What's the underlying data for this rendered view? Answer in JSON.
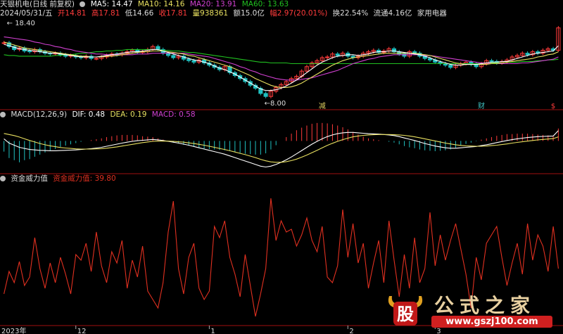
{
  "header": {
    "stock": "天银机电(日线 前复权)",
    "ma5": "MA5: 14.47",
    "ma10": "MA10: 14.16",
    "ma20": "MA20: 13.91",
    "ma60": "MA60: 13.63",
    "date": "2024/05/31/五",
    "open": "开14.81",
    "high": "高17.81",
    "low": "低14.66",
    "close": "收17.81",
    "volume": "量938361",
    "amount": "额15.0亿",
    "change": "幅2.97(20.01%)",
    "turnover": "换22.54%",
    "float": "流通4.16亿",
    "industry": "家用电器"
  },
  "macd_header": {
    "label": "MACD(12,26,9)",
    "dif": "DIF: 0.48",
    "dea": "DEA: 0.19",
    "macd": "MACD: 0.58"
  },
  "power_header": {
    "label": "资金威力值",
    "value": "资金威力值: 39.80"
  },
  "colors": {
    "up": "#ff3b3b",
    "down": "#20c0c0",
    "ma5": "#ffffff",
    "ma10": "#e8e060",
    "ma20": "#d040d0",
    "ma60": "#20c020",
    "dif": "#ffffff",
    "dea": "#e8e060",
    "power": "#e03020",
    "grid": "#a01010",
    "label_yellow": "#e0d060",
    "label_cyan": "#40c0c0"
  },
  "chart_data": [
    {
      "type": "candlestick",
      "title": "天银机电(日线 前复权)",
      "price_labels": {
        "high": "18.40",
        "low": "8.00"
      },
      "ylim": [
        7.2,
        18.9
      ],
      "markers": [
        {
          "text": "减",
          "index": 62
        },
        {
          "text": "财",
          "index": 93
        },
        {
          "text": "$",
          "index": 107
        }
      ],
      "closes": [
        15.8,
        15.3,
        14.9,
        15.1,
        14.7,
        14.6,
        14.9,
        14.6,
        14.4,
        14.3,
        14.4,
        14.2,
        14.0,
        14.1,
        13.9,
        13.8,
        14.0,
        13.7,
        13.7,
        13.9,
        14.1,
        14.3,
        14.2,
        14.4,
        14.6,
        14.8,
        14.5,
        14.6,
        14.9,
        15.3,
        14.9,
        14.4,
        14.1,
        13.8,
        14.0,
        13.6,
        13.4,
        13.2,
        13.5,
        13.1,
        12.8,
        12.5,
        12.2,
        12.6,
        11.8,
        11.4,
        11.0,
        10.6,
        10.1,
        9.7,
        9.0,
        8.6,
        9.3,
        9.8,
        10.2,
        10.6,
        11.0,
        11.3,
        12.0,
        12.6,
        13.1,
        13.4,
        13.8,
        13.9,
        14.3,
        14.1,
        14.4,
        14.0,
        13.8,
        14.0,
        14.4,
        14.6,
        14.8,
        14.5,
        14.7,
        15.0,
        14.6,
        14.3,
        14.0,
        14.6,
        14.4,
        14.0,
        13.7,
        13.5,
        13.2,
        13.0,
        12.8,
        12.5,
        12.8,
        13.0,
        13.2,
        12.9,
        12.6,
        13.0,
        13.4,
        13.3,
        13.1,
        13.3,
        13.5,
        13.9,
        14.1,
        14.4,
        14.2,
        14.6,
        14.4,
        14.8,
        15.0,
        14.8,
        17.8
      ],
      "ma5": [
        15.6,
        15.4,
        15.2,
        15.0,
        14.9,
        14.8,
        14.7,
        14.6,
        14.5,
        14.4,
        14.4,
        14.3,
        14.2,
        14.1,
        14.0,
        13.9,
        13.9,
        13.9,
        13.9,
        14.0,
        14.1,
        14.2,
        14.3,
        14.4,
        14.5,
        14.6,
        14.6,
        14.7,
        14.8,
        14.9,
        14.9,
        14.7,
        14.5,
        14.3,
        14.1,
        13.9,
        13.7,
        13.5,
        13.4,
        13.2,
        13.0,
        12.7,
        12.4,
        12.2,
        11.9,
        11.6,
        11.2,
        10.8,
        10.4,
        10.0,
        9.6,
        9.4,
        9.4,
        9.5,
        9.7,
        10.0,
        10.4,
        10.8,
        11.3,
        11.8,
        12.3,
        12.8,
        13.2,
        13.5,
        13.8,
        14.0,
        14.1,
        14.2,
        14.2,
        14.1,
        14.2,
        14.3,
        14.5,
        14.6,
        14.6,
        14.7,
        14.7,
        14.6,
        14.5,
        14.4,
        14.3,
        14.2,
        14.0,
        13.8,
        13.5,
        13.3,
        13.1,
        12.9,
        12.8,
        12.8,
        12.9,
        12.9,
        12.9,
        13.0,
        13.1,
        13.2,
        13.2,
        13.3,
        13.3,
        13.5,
        13.7,
        13.9,
        14.1,
        14.3,
        14.4,
        14.5,
        14.6,
        14.7,
        15.4
      ],
      "ma10": [
        15.9,
        15.7,
        15.5,
        15.3,
        15.1,
        15.0,
        14.9,
        14.8,
        14.7,
        14.6,
        14.5,
        14.4,
        14.3,
        14.2,
        14.1,
        14.0,
        14.0,
        13.9,
        13.9,
        13.9,
        14.0,
        14.0,
        14.1,
        14.2,
        14.3,
        14.4,
        14.5,
        14.6,
        14.6,
        14.7,
        14.7,
        14.7,
        14.6,
        14.5,
        14.4,
        14.3,
        14.1,
        14.0,
        13.8,
        13.6,
        13.4,
        13.2,
        13.0,
        12.8,
        12.6,
        12.3,
        12.0,
        11.7,
        11.4,
        11.0,
        10.7,
        10.4,
        10.1,
        9.9,
        9.8,
        9.8,
        9.9,
        10.1,
        10.4,
        10.8,
        11.2,
        11.6,
        12.0,
        12.4,
        12.8,
        13.1,
        13.4,
        13.6,
        13.8,
        13.9,
        14.0,
        14.1,
        14.2,
        14.3,
        14.4,
        14.4,
        14.4,
        14.4,
        14.4,
        14.4,
        14.4,
        14.3,
        14.2,
        14.1,
        13.9,
        13.7,
        13.5,
        13.3,
        13.1,
        13.0,
        12.9,
        12.9,
        12.9,
        12.9,
        12.9,
        13.0,
        13.0,
        13.1,
        13.2,
        13.3,
        13.4,
        13.5,
        13.6,
        13.7,
        13.9,
        14.0,
        14.2,
        14.3,
        14.6
      ],
      "ma20": [
        16.6,
        16.5,
        16.4,
        16.3,
        16.2,
        16.1,
        15.9,
        15.8,
        15.6,
        15.5,
        15.3,
        15.2,
        15.0,
        14.9,
        14.7,
        14.6,
        14.5,
        14.4,
        14.3,
        14.3,
        14.2,
        14.2,
        14.2,
        14.2,
        14.2,
        14.2,
        14.3,
        14.3,
        14.3,
        14.4,
        14.4,
        14.4,
        14.4,
        14.4,
        14.4,
        14.4,
        14.3,
        14.2,
        14.1,
        14.0,
        13.9,
        13.7,
        13.5,
        13.3,
        13.1,
        12.9,
        12.6,
        12.4,
        12.1,
        11.9,
        11.6,
        11.4,
        11.2,
        11.0,
        10.9,
        10.8,
        10.8,
        10.8,
        10.9,
        11.0,
        11.1,
        11.3,
        11.5,
        11.7,
        11.9,
        12.1,
        12.4,
        12.7,
        13.0,
        13.2,
        13.4,
        13.6,
        13.7,
        13.9,
        14.0,
        14.1,
        14.2,
        14.2,
        14.2,
        14.2,
        14.2,
        14.2,
        14.1,
        14.1,
        14.0,
        13.9,
        13.8,
        13.7,
        13.6,
        13.5,
        13.4,
        13.3,
        13.2,
        13.1,
        13.1,
        13.0,
        13.0,
        13.0,
        13.0,
        13.0,
        13.0,
        13.1,
        13.1,
        13.2,
        13.3,
        13.4,
        13.5,
        13.6,
        13.9
      ],
      "ma60": [
        14.2,
        14.1,
        14.1,
        14.0,
        14.0,
        14.0,
        14.0,
        14.0,
        14.0,
        14.0,
        14.1,
        14.1,
        14.2,
        14.2,
        14.3,
        14.4,
        14.4,
        14.5,
        14.6,
        14.6,
        14.7,
        14.7,
        14.8,
        14.8,
        14.9,
        14.9,
        14.9,
        14.9,
        14.9,
        14.9,
        14.9,
        14.8,
        14.8,
        14.7,
        14.7,
        14.6,
        14.5,
        14.5,
        14.4,
        14.3,
        14.2,
        14.1,
        14.0,
        13.9,
        13.8,
        13.7,
        13.6,
        13.5,
        13.4,
        13.3,
        13.2,
        13.2,
        13.1,
        13.1,
        13.1,
        13.1,
        13.0,
        13.0,
        13.0,
        13.0,
        13.0,
        13.0,
        13.0,
        13.0,
        13.0,
        13.0,
        13.0,
        13.0,
        13.0,
        13.0,
        13.0,
        13.0,
        13.0,
        13.0,
        13.0,
        13.0,
        13.0,
        13.0,
        13.0,
        13.0,
        13.0,
        13.0,
        13.0,
        13.0,
        13.0,
        13.0,
        13.0,
        13.0,
        13.0,
        13.0,
        13.0,
        13.0,
        13.0,
        13.0,
        13.1,
        13.1,
        13.1,
        13.1,
        13.2,
        13.2,
        13.2,
        13.3,
        13.3,
        13.3,
        13.4,
        13.4,
        13.5,
        13.5,
        13.6
      ]
    },
    {
      "type": "macd",
      "title": "MACD(12,26,9)",
      "ylim": [
        -1.4,
        1.0
      ],
      "dif": [
        0.1,
        -0.1,
        -0.2,
        -0.3,
        -0.35,
        -0.4,
        -0.42,
        -0.44,
        -0.45,
        -0.46,
        -0.46,
        -0.45,
        -0.44,
        -0.43,
        -0.42,
        -0.4,
        -0.38,
        -0.36,
        -0.33,
        -0.3,
        -0.25,
        -0.2,
        -0.15,
        -0.1,
        -0.06,
        -0.02,
        0.01,
        0.03,
        0.05,
        0.07,
        0.05,
        0.02,
        -0.02,
        -0.06,
        -0.1,
        -0.15,
        -0.2,
        -0.26,
        -0.32,
        -0.38,
        -0.44,
        -0.5,
        -0.56,
        -0.62,
        -0.7,
        -0.78,
        -0.86,
        -0.94,
        -1.02,
        -1.1,
        -1.18,
        -1.22,
        -1.18,
        -1.1,
        -1.0,
        -0.88,
        -0.75,
        -0.6,
        -0.45,
        -0.3,
        -0.15,
        -0.02,
        0.1,
        0.2,
        0.28,
        0.34,
        0.38,
        0.4,
        0.4,
        0.38,
        0.36,
        0.34,
        0.33,
        0.32,
        0.3,
        0.28,
        0.25,
        0.2,
        0.14,
        0.08,
        0.02,
        -0.05,
        -0.12,
        -0.18,
        -0.24,
        -0.28,
        -0.32,
        -0.34,
        -0.34,
        -0.32,
        -0.3,
        -0.28,
        -0.26,
        -0.22,
        -0.18,
        -0.13,
        -0.08,
        -0.03,
        0.02,
        0.06,
        0.1,
        0.13,
        0.16,
        0.18,
        0.2,
        0.21,
        0.22,
        0.23,
        0.48
      ],
      "dea": [
        0.35,
        0.3,
        0.25,
        0.18,
        0.1,
        0.02,
        -0.05,
        -0.12,
        -0.18,
        -0.23,
        -0.27,
        -0.31,
        -0.33,
        -0.35,
        -0.37,
        -0.38,
        -0.38,
        -0.38,
        -0.37,
        -0.36,
        -0.34,
        -0.31,
        -0.28,
        -0.24,
        -0.2,
        -0.16,
        -0.12,
        -0.08,
        -0.05,
        -0.02,
        -0.01,
        -0.01,
        -0.01,
        -0.02,
        -0.04,
        -0.06,
        -0.09,
        -0.12,
        -0.16,
        -0.2,
        -0.25,
        -0.3,
        -0.35,
        -0.4,
        -0.46,
        -0.52,
        -0.58,
        -0.64,
        -0.71,
        -0.78,
        -0.86,
        -0.93,
        -0.98,
        -1.0,
        -1.0,
        -0.97,
        -0.92,
        -0.85,
        -0.76,
        -0.66,
        -0.55,
        -0.44,
        -0.32,
        -0.21,
        -0.11,
        -0.02,
        0.06,
        0.13,
        0.19,
        0.23,
        0.26,
        0.28,
        0.29,
        0.3,
        0.3,
        0.3,
        0.29,
        0.28,
        0.26,
        0.23,
        0.19,
        0.15,
        0.1,
        0.05,
        0.0,
        -0.05,
        -0.1,
        -0.14,
        -0.18,
        -0.21,
        -0.23,
        -0.24,
        -0.25,
        -0.25,
        -0.24,
        -0.22,
        -0.2,
        -0.17,
        -0.14,
        -0.1,
        -0.07,
        -0.04,
        -0.01,
        0.02,
        0.05,
        0.07,
        0.09,
        0.11,
        0.19
      ],
      "hist": [
        -0.5,
        -0.8,
        -0.9,
        -1.0,
        -0.9,
        -0.85,
        -0.74,
        -0.64,
        -0.54,
        -0.46,
        -0.38,
        -0.28,
        -0.22,
        -0.16,
        -0.1,
        -0.04,
        0.0,
        0.04,
        0.08,
        0.12,
        0.18,
        0.22,
        0.26,
        0.28,
        0.28,
        0.28,
        0.26,
        0.22,
        0.2,
        0.18,
        0.12,
        0.06,
        -0.02,
        -0.08,
        -0.12,
        -0.18,
        -0.22,
        -0.28,
        -0.32,
        -0.36,
        -0.38,
        -0.4,
        -0.42,
        -0.44,
        -0.48,
        -0.52,
        -0.56,
        -0.6,
        -0.62,
        -0.64,
        -0.64,
        -0.58,
        -0.4,
        -0.2,
        0.0,
        0.18,
        0.34,
        0.5,
        0.62,
        0.72,
        0.8,
        0.84,
        0.84,
        0.82,
        0.78,
        0.72,
        0.64,
        0.54,
        0.42,
        0.3,
        0.2,
        0.12,
        0.08,
        0.04,
        0.0,
        -0.04,
        -0.08,
        -0.16,
        -0.24,
        -0.3,
        -0.34,
        -0.4,
        -0.44,
        -0.46,
        -0.48,
        -0.46,
        -0.44,
        -0.4,
        -0.32,
        -0.22,
        -0.14,
        -0.08,
        -0.02,
        0.06,
        0.12,
        0.18,
        0.24,
        0.28,
        0.32,
        0.32,
        0.34,
        0.34,
        0.34,
        0.32,
        0.3,
        0.28,
        0.26,
        0.24,
        0.58
      ]
    },
    {
      "type": "line",
      "title": "资金威力值",
      "ylim": [
        0,
        100
      ],
      "last_value": 39.8,
      "values": [
        22,
        38,
        30,
        45,
        28,
        34,
        62,
        40,
        26,
        44,
        30,
        48,
        36,
        22,
        50,
        46,
        58,
        38,
        66,
        42,
        30,
        52,
        44,
        60,
        26,
        46,
        34,
        56,
        24,
        18,
        12,
        30,
        66,
        88,
        40,
        22,
        48,
        58,
        26,
        18,
        24,
        70,
        62,
        74,
        48,
        36,
        20,
        50,
        28,
        6,
        22,
        40,
        90,
        60,
        74,
        66,
        68,
        56,
        64,
        76,
        60,
        52,
        70,
        34,
        30,
        42,
        82,
        48,
        72,
        44,
        58,
        26,
        44,
        60,
        30,
        74,
        46,
        20,
        50,
        26,
        62,
        30,
        40,
        80,
        42,
        64,
        46,
        60,
        72,
        54,
        36,
        12,
        48,
        32,
        58,
        64,
        70,
        48,
        28,
        44,
        58,
        36,
        72,
        46,
        64,
        56,
        38,
        70,
        40
      ]
    }
  ],
  "x_axis": {
    "labels": [
      "2023年",
      "12",
      "1",
      "2",
      "3"
    ],
    "indices": [
      0,
      14,
      40,
      67,
      84
    ]
  },
  "watermark": {
    "title": "公式之家",
    "url": "www.gszj100.com",
    "logo_char": "股"
  }
}
